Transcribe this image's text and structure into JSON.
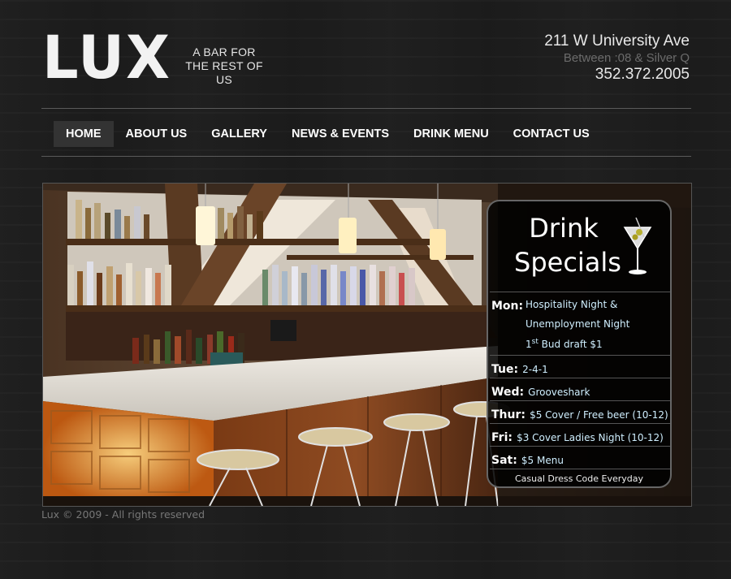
{
  "brand": {
    "logo": "LUX",
    "tagline": "A BAR FOR THE REST OF US"
  },
  "contact": {
    "street": "211 W University Ave",
    "cross_streets": "Between :08 & Silver Q",
    "phone": "352.372.2005"
  },
  "nav": {
    "items": [
      {
        "label": "HOME",
        "active": true
      },
      {
        "label": "ABOUT US"
      },
      {
        "label": "GALLERY"
      },
      {
        "label": "NEWS & EVENTS"
      },
      {
        "label": "DRINK MENU"
      },
      {
        "label": "CONTACT US"
      }
    ]
  },
  "specials": {
    "title_line1": "Drink",
    "title_line2": "Specials",
    "mon_day": "Mon:",
    "mon_line1": "Hospitality Night &",
    "mon_line2": "Unemployment Night",
    "mon_line3_sup": "st",
    "mon_line3_pre": "1",
    "mon_line3_post": " Bud draft $1",
    "tue_day": "Tue:",
    "tue_text": "2-4-1",
    "wed_day": "Wed:",
    "wed_text": "Grooveshark",
    "thur_day": "Thur:",
    "thur_text": "$5 Cover / Free beer (10-12)",
    "fri_day": "Fri:",
    "fri_text": "$3 Cover Ladies Night (10-12)",
    "sat_day": "Sat:",
    "sat_text": "$5 Menu",
    "note": "Casual Dress Code Everyday"
  },
  "footer": {
    "copyright": "Lux © 2009 - All rights reserved"
  },
  "colors": {
    "background": "#1c1c1c",
    "accent_text": "#cfefff",
    "nav_active_bg": "#333333"
  },
  "icons": [
    "martini-icon"
  ]
}
